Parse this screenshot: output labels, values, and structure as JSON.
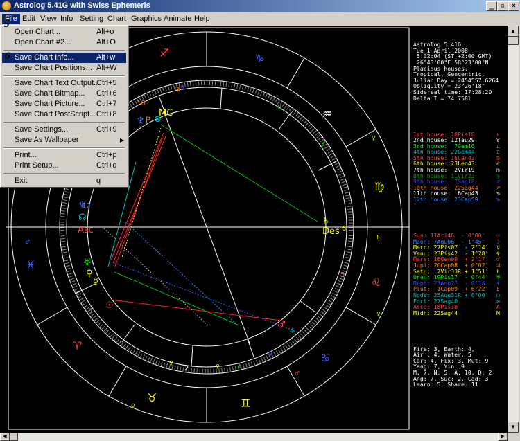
{
  "window": {
    "title": "Astrolog 5.41G with Swiss Ephemeris",
    "min_glyph": "_",
    "max_glyph": "▫",
    "close_glyph": "×"
  },
  "menubar": [
    "File",
    "Edit",
    "View",
    "Info",
    "Setting",
    "Chart",
    "Graphics",
    "Animate",
    "Help"
  ],
  "step_labels": {
    "a": "5",
    "b": "6"
  },
  "file_menu": [
    {
      "label": "Open Chart...",
      "accel": "Alt+o"
    },
    {
      "label": "Open Chart #2...",
      "accel": "Alt+O"
    },
    {
      "label": "Save Chart Info...",
      "accel": "Alt+w"
    },
    {
      "label": "Save Chart Positions...",
      "accel": "Alt+W"
    },
    {
      "label": "Save Chart Text Output...",
      "accel": "Ctrl+5"
    },
    {
      "label": "Save Chart Bitmap...",
      "accel": "Ctrl+6"
    },
    {
      "label": "Save Chart Picture...",
      "accel": "Ctrl+7"
    },
    {
      "label": "Save Chart PostScript...",
      "accel": "Ctrl+8"
    },
    {
      "label": "Save Settings...",
      "accel": "Ctrl+9"
    },
    {
      "label": "Save As Wallpaper",
      "accel": ""
    },
    {
      "label": "Print...",
      "accel": "Ctrl+p"
    },
    {
      "label": "Print Setup...",
      "accel": "Ctrl+q"
    },
    {
      "label": "Exit",
      "accel": "q"
    }
  ],
  "colors": {
    "highlight": "#0a246a",
    "chart_bg": "#000000"
  },
  "chart_labels": {
    "mc": "MC",
    "asc": "Asc",
    "des": "Des",
    "houses": [
      "1",
      "2",
      "3",
      "4",
      "5",
      "6",
      "7",
      "8",
      "9",
      "10",
      "11",
      "12"
    ]
  },
  "info_header": [
    "Astrolog 5.41G",
    "Tue 1 April 2008",
    " 5:02:04 (ST +2:00 GMT)",
    " 26°43'00\"E 58°23'00\"N",
    "Placidus houses.",
    "Tropical, Geocentric.",
    "Julian Day = 2454557.6264",
    "Obliquity = 23°26'18\"",
    "Sidereal time: 17:28:20",
    "Delta T = 74.758l"
  ],
  "houses": [
    {
      "text": "1st house: 18Pis18",
      "color": "#ff4040",
      "sym": "♓"
    },
    {
      "text": "2nd house: 12Tau29",
      "color": "#ffffff",
      "sym": "♉"
    },
    {
      "text": "3rd house:  7Gem10",
      "color": "#00ff00",
      "sym": "♊"
    },
    {
      "text": "4th house: 22Gem44",
      "color": "#00c0c0",
      "sym": "♊"
    },
    {
      "text": "5th house: 16Can43",
      "color": "#ff4040",
      "sym": "♋"
    },
    {
      "text": "6th house: 23Leo43",
      "color": "#ffff00",
      "sym": "♌"
    },
    {
      "text": "7th house:  2Vir19",
      "color": "#ffffff",
      "sym": "♍"
    },
    {
      "text": "8th house: 11Vir23",
      "color": "#00a000",
      "sym": "♍"
    },
    {
      "text": "9th house:  7Sag18",
      "color": "#4040ff",
      "sym": "♐"
    },
    {
      "text": "10th house: 22Sag44",
      "color": "#ff8000",
      "sym": "♐"
    },
    {
      "text": "11th house:  6Cap43",
      "color": "#ffffff",
      "sym": "♑"
    },
    {
      "text": "12th house: 23Cap59",
      "color": "#4080ff",
      "sym": "♑"
    }
  ],
  "planets": [
    {
      "text": "Sun: 11Ari46  - 0°00'",
      "color": "#ff4040",
      "sym": "☉"
    },
    {
      "text": "Moon: 7Aqu06  - 1°45'",
      "color": "#4080ff",
      "sym": "☽"
    },
    {
      "text": "Merc: 27Pis07  - 2°14'",
      "color": "#ffff00",
      "sym": "☿"
    },
    {
      "text": "Venu: 23Pis42  - 1°28'",
      "color": "#ffff00",
      "sym": "♀"
    },
    {
      "text": "Mars: 18Gem00  + 2°17'",
      "color": "#ff4040",
      "sym": "♂"
    },
    {
      "text": "Jupi: 20Cap08  + 0°02'",
      "color": "#ff8000",
      "sym": "♃"
    },
    {
      "text": "Satu:  2Vir33R + 1°51'",
      "color": "#ffff00",
      "sym": "♄"
    },
    {
      "text": "Uran: 19Pis17  - 0°44'",
      "color": "#00ff00",
      "sym": "♅"
    },
    {
      "text": "Nept: 23Aqu27  - 0°18'",
      "color": "#4040ff",
      "sym": "♆"
    },
    {
      "text": "Plut:  1Cap09  + 6°22'",
      "color": "#ff8000",
      "sym": "♇"
    },
    {
      "text": "Node: 25Aqu31R + 0°00'",
      "color": "#00c0c0",
      "sym": "☊"
    },
    {
      "text": "Fort: 27Sag40",
      "color": "#00c0c0",
      "sym": "⊗"
    },
    {
      "text": "Asce: 18Pis18",
      "color": "#ff4040",
      "sym": "A"
    },
    {
      "text": "Midh: 22Sag44",
      "color": "#ffff00",
      "sym": "M"
    }
  ],
  "summary": [
    "Fire: 3, Earth: 4,",
    "Air : 4, Water: 5",
    "Car: 4, Fix: 3, Mut: 9",
    "Yang: 7, Yin: 9",
    "M: 7, N: 5, A: 10, D: 2",
    "Ang: 7, Suc: 2, Cad: 3",
    "Learn: 5, Share: 11"
  ]
}
